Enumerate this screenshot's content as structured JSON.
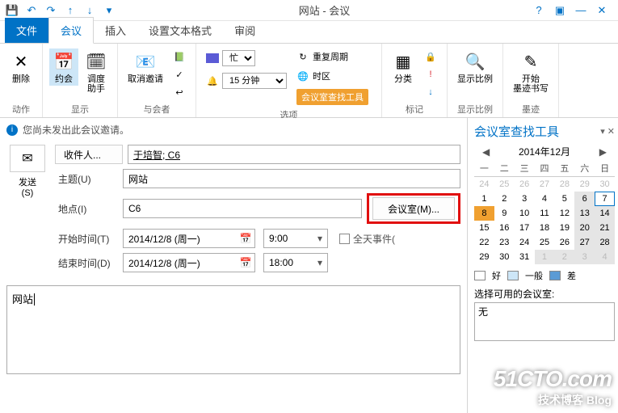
{
  "window": {
    "title": "网站 - 会议"
  },
  "qat": {
    "save_icon": "💾",
    "undo_icon": "↶",
    "redo_icon": "↷",
    "prev_icon": "↑",
    "next_icon": "↓",
    "more_icon": "▾"
  },
  "window_controls": {
    "help": "?",
    "ribbon_toggle": "▣",
    "minimize": "—",
    "close": "✕"
  },
  "tabs": {
    "file": "文件",
    "meeting": "会议",
    "insert": "插入",
    "format": "设置文本格式",
    "review": "审阅"
  },
  "ribbon": {
    "actions": {
      "label": "动作",
      "delete": "删除"
    },
    "show": {
      "label": "显示",
      "appointment": "约会",
      "scheduling": "调度\n助手"
    },
    "attendees": {
      "label": "与会者",
      "cancel": "取消邀请"
    },
    "options": {
      "label": "选项",
      "showas_label": "忙",
      "reminder_value": "15 分钟",
      "recurrence": "重复周期",
      "timezone": "时区",
      "roomfinder_tool": "会议室查找工具"
    },
    "tags": {
      "label": "标记",
      "categorize": "分类"
    },
    "zoom": {
      "label": "显示比例",
      "btn": "显示比例"
    },
    "ink": {
      "label": "墨迹",
      "btn": "开始\n墨迹书写"
    }
  },
  "info_bar": {
    "text": "您尚未发出此会议邀请。"
  },
  "form": {
    "send_label": "发送\n(S)",
    "to_label": "收件人...",
    "to_value": "于培智; C6",
    "subject_label": "主题(U)",
    "subject_value": "网站",
    "location_label": "地点(I)",
    "location_value": "C6",
    "rooms_btn": "会议室(M)...",
    "start_label": "开始时间(T)",
    "start_date": "2014/12/8 (周一)",
    "start_time": "9:00",
    "allday_label": "全天事件(",
    "end_label": "结束时间(D)",
    "end_date": "2014/12/8 (周一)",
    "end_time": "18:00",
    "body": "网站"
  },
  "finder": {
    "title": "会议室查找工具",
    "month": "2014年12月",
    "weekdays": [
      "一",
      "二",
      "三",
      "四",
      "五",
      "六",
      "日"
    ],
    "prev_tail": [
      "24",
      "25",
      "26",
      "27",
      "28",
      "29",
      "30"
    ],
    "days": [
      "1",
      "2",
      "3",
      "4",
      "5",
      "6",
      "7",
      "8",
      "9",
      "10",
      "11",
      "12",
      "13",
      "14",
      "15",
      "16",
      "17",
      "18",
      "19",
      "20",
      "21",
      "22",
      "23",
      "24",
      "25",
      "26",
      "27",
      "28",
      "29",
      "30",
      "31"
    ],
    "next_head": [
      "1",
      "2",
      "3",
      "4"
    ],
    "legend": {
      "good": "好",
      "fair": "一般",
      "poor": "差"
    },
    "choose_label": "选择可用的会议室:",
    "none": "无"
  },
  "watermark": {
    "line1": "51CTO.com",
    "line2": "技术博客  Blog"
  }
}
